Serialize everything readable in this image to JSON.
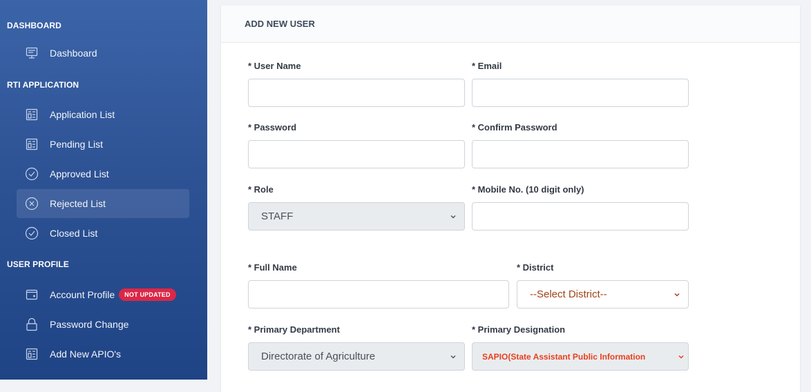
{
  "sidebar": {
    "sections": {
      "dashboard": "DASHBOARD",
      "rti": "RTI APPLICATION",
      "user": "USER PROFILE"
    },
    "items": [
      {
        "label": "Dashboard",
        "icon": "dashboard-icon"
      },
      {
        "label": "Application List",
        "icon": "document-list-icon"
      },
      {
        "label": "Pending List",
        "icon": "document-list-icon"
      },
      {
        "label": "Approved List",
        "icon": "check-circle-icon"
      },
      {
        "label": "Rejected List",
        "icon": "x-circle-icon"
      },
      {
        "label": "Closed List",
        "icon": "check-circle-icon"
      },
      {
        "label": "Account Profile",
        "icon": "wallet-icon",
        "badge": "NOT UPDATED"
      },
      {
        "label": "Password Change",
        "icon": "lock-icon"
      },
      {
        "label": "Add New APIO's",
        "icon": "document-list-icon"
      }
    ]
  },
  "form": {
    "title": "ADD NEW USER",
    "user_name": {
      "label": "* User Name",
      "value": "",
      "placeholder": ""
    },
    "email": {
      "label": "* Email",
      "value": "",
      "placeholder": ""
    },
    "password": {
      "label": "* Password",
      "value": "",
      "placeholder": ""
    },
    "confirm_password": {
      "label": "* Confirm Password",
      "value": "",
      "placeholder": ""
    },
    "role": {
      "label": "* Role",
      "selected": "STAFF"
    },
    "mobile": {
      "label": "* Mobile No. (10 digit only)",
      "value": "",
      "placeholder": ""
    },
    "full_name": {
      "label": "* Full Name",
      "value": "",
      "placeholder": ""
    },
    "district": {
      "label": "* District",
      "selected": "--Select District--"
    },
    "primary_department": {
      "label": "* Primary Department",
      "selected": "Directorate of Agriculture"
    },
    "primary_designation": {
      "label": "* Primary Designation",
      "selected": "SAPIO(State Assistant Public Information"
    }
  },
  "colors": {
    "sidebar_top": "#3b64a8",
    "sidebar_bottom": "#1f4485",
    "badge": "#dc2747",
    "district_text": "#a0441a",
    "designation_text": "#e8401c"
  }
}
